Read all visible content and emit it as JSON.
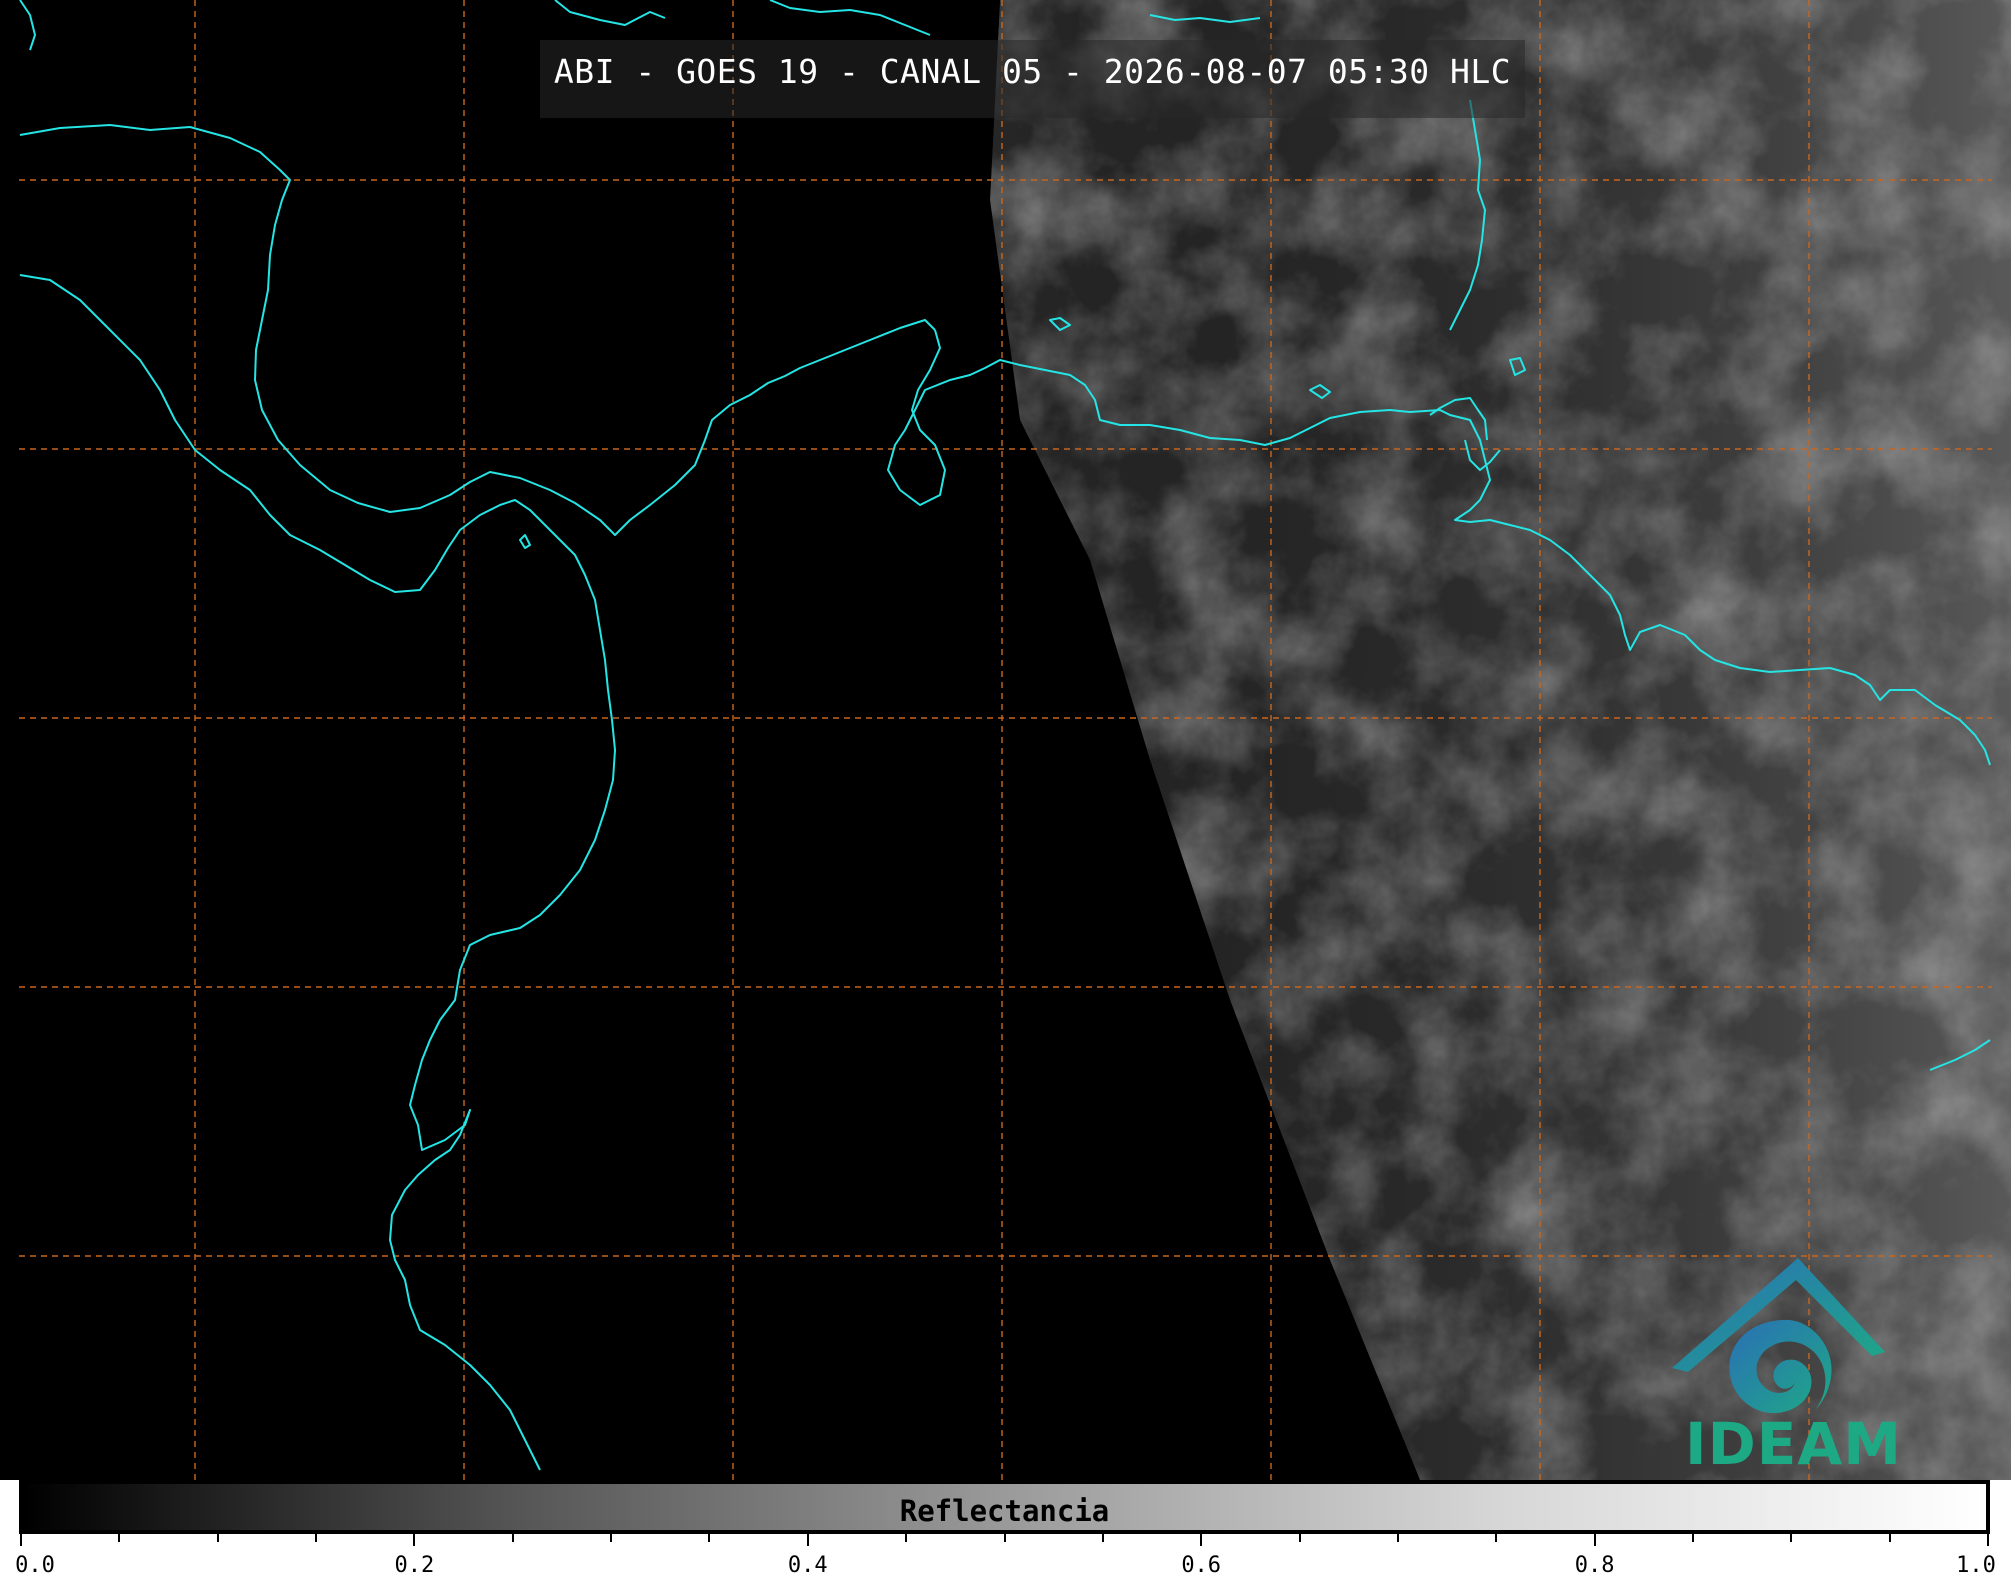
{
  "title": "ABI - GOES 19 - CANAL 05 - 2026-08-07 05:30 HLC",
  "logo": {
    "text": "IDEAM",
    "color": "#1ea985"
  },
  "colorbar": {
    "label": "Reflectancia",
    "ticks": [
      "0.0",
      "0.2",
      "0.4",
      "0.6",
      "0.8",
      "1.0"
    ],
    "range": [
      0.0,
      1.0
    ]
  },
  "colors": {
    "coastline": "#25e4e4",
    "gridlines": "#c8661e",
    "background": "#000000"
  }
}
